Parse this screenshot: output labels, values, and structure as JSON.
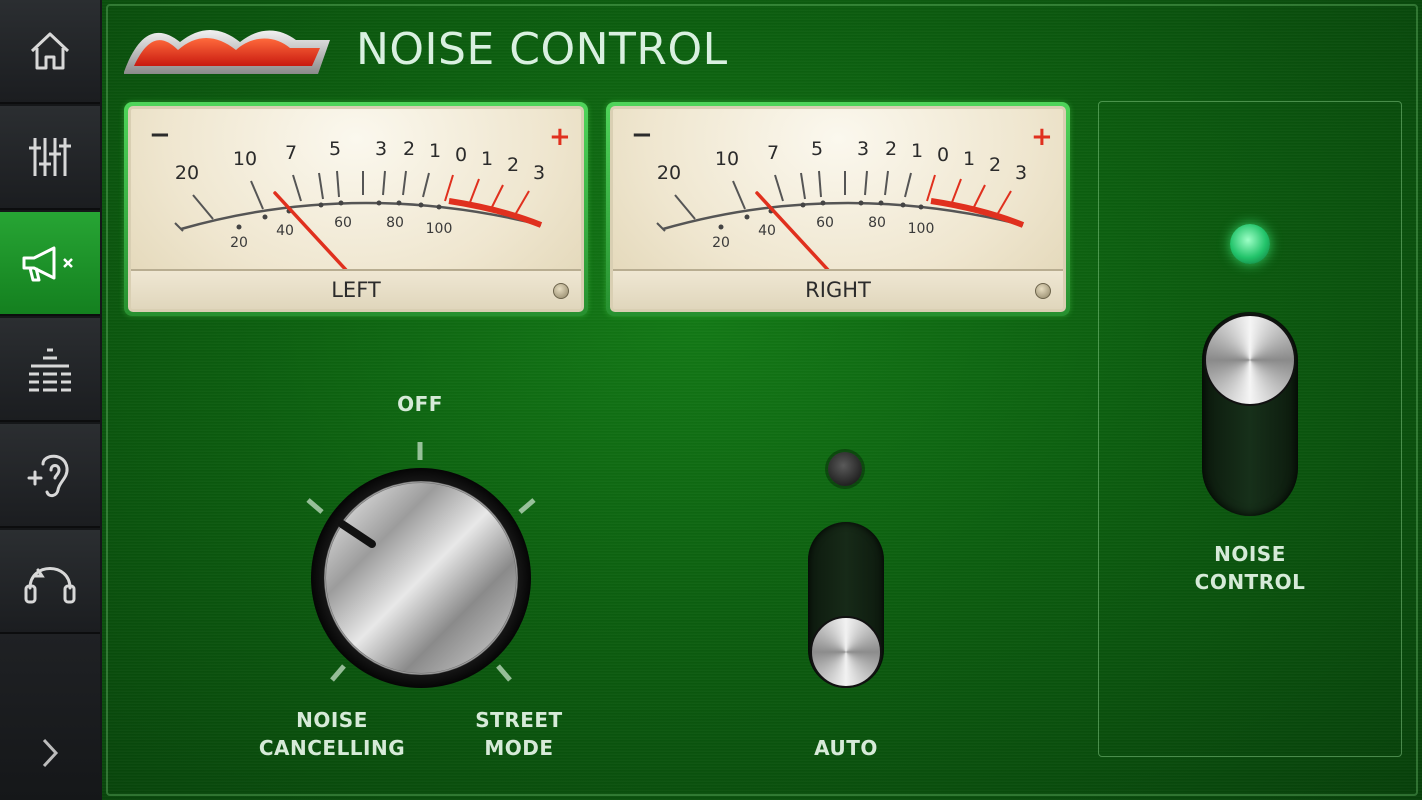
{
  "sidebar": {
    "items": [
      {
        "name": "home",
        "icon": "home-icon"
      },
      {
        "name": "mixer",
        "icon": "sliders-icon"
      },
      {
        "name": "noise-control",
        "icon": "megaphone-mute-icon",
        "active": true
      },
      {
        "name": "equalizer",
        "icon": "equalizer-icon"
      },
      {
        "name": "hearing",
        "icon": "ear-plus-icon"
      },
      {
        "name": "headphones",
        "icon": "headphones-refresh-icon"
      }
    ],
    "expand_icon": "chevron-right-icon"
  },
  "header": {
    "title": "NOISE CONTROL"
  },
  "meters": {
    "left": {
      "label": "LEFT",
      "minus": "−",
      "plus": "+",
      "level_db": -8
    },
    "right": {
      "label": "RIGHT",
      "minus": "−",
      "plus": "+",
      "level_db": -8
    },
    "db_ticks": [
      "20",
      "10",
      "7",
      "5",
      "3",
      "2",
      "1",
      "0",
      "1",
      "2",
      "3"
    ],
    "percent_ticks": [
      "20",
      "40",
      "60",
      "80",
      "100"
    ]
  },
  "mode_knob": {
    "off_label": "OFF",
    "left_label_line1": "NOISE",
    "left_label_line2": "CANCELLING",
    "right_label_line1": "STREET",
    "right_label_line2": "MODE",
    "selected": "NOISE CANCELLING"
  },
  "auto_switch": {
    "label": "AUTO",
    "state": "off"
  },
  "noise_control_switch": {
    "label_line1": "NOISE",
    "label_line2": "CONTROL",
    "state": "on"
  },
  "colors": {
    "active_green": "#1f9a2c",
    "indicator_on": "#3be07a",
    "meter_red": "#e0301e"
  }
}
